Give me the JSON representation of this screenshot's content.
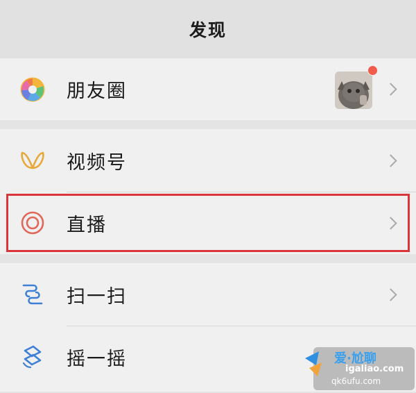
{
  "header": {
    "title": "发现"
  },
  "items": [
    {
      "label": "朋友圈",
      "icon": "moments-aperture-icon"
    },
    {
      "label": "视频号",
      "icon": "channels-icon"
    },
    {
      "label": "直播",
      "icon": "live-icon"
    },
    {
      "label": "扫一扫",
      "icon": "scan-icon"
    },
    {
      "label": "摇一摇",
      "icon": "shake-icon"
    }
  ],
  "moments_preview": {
    "badge": "unread-dot",
    "badge_color": "#f25a4a"
  },
  "highlight_color": "#d8363a",
  "watermark": {
    "line1": "爱·尬聊",
    "line2": "igaliao.com",
    "line3": "qk6ufu.com"
  }
}
